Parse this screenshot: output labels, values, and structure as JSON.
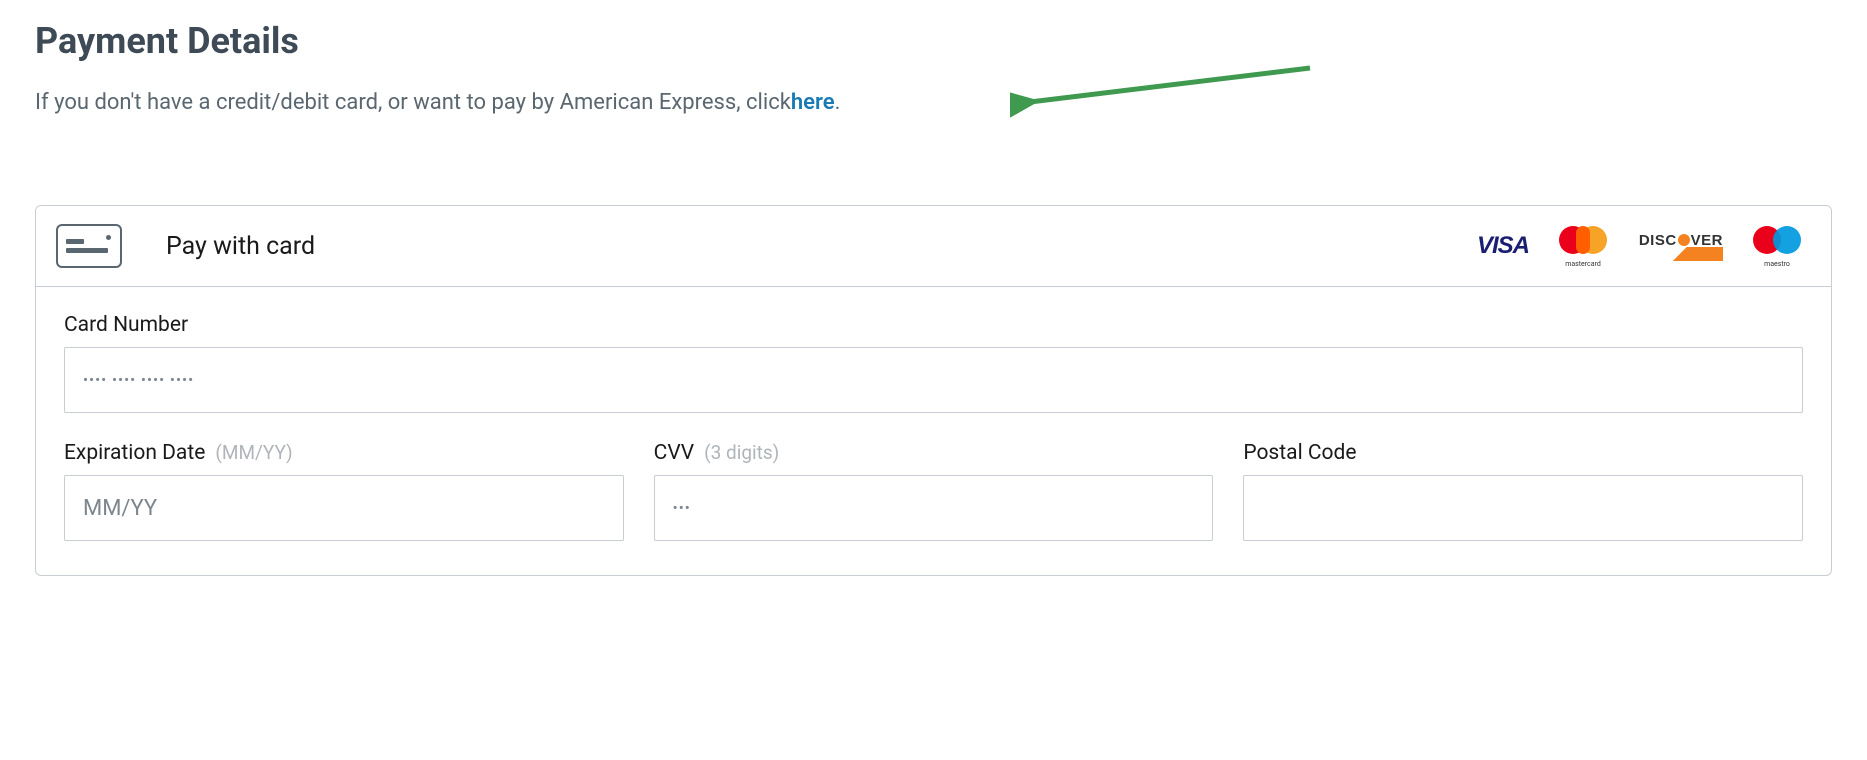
{
  "title": "Payment Details",
  "helpText": {
    "prefix": "If you don't have a credit/debit card, or want to pay by American Express, click ",
    "linkText": "here",
    "suffix": "."
  },
  "paymentCard": {
    "headerLabel": "Pay with card",
    "logos": {
      "visa": "VISA",
      "mastercard_sub": "mastercard",
      "discover_pre": "DISC",
      "discover_post": "VER",
      "maestro_sub": "maestro"
    },
    "fields": {
      "cardNumber": {
        "label": "Card Number",
        "placeholder": "•••• •••• •••• ••••",
        "value": ""
      },
      "expiration": {
        "label": "Expiration Date",
        "hint": "(MM/YY)",
        "placeholder": "MM/YY",
        "value": ""
      },
      "cvv": {
        "label": "CVV",
        "hint": "(3 digits)",
        "placeholder": "•••",
        "value": ""
      },
      "postal": {
        "label": "Postal Code",
        "placeholder": "",
        "value": ""
      }
    }
  },
  "colors": {
    "link": "#1a7ab3",
    "arrow": "#3f9a4f"
  }
}
